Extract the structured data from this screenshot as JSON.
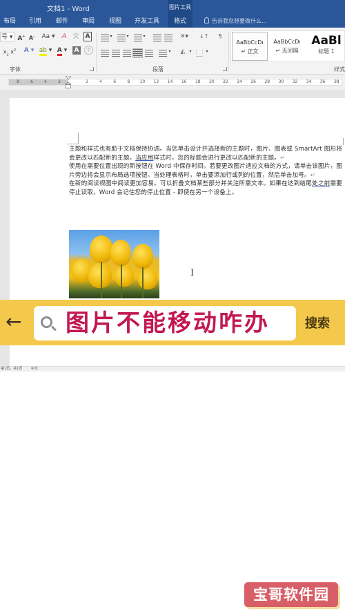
{
  "window": {
    "title": "文档1 - Word",
    "context_tab_group": "图片工具"
  },
  "tabs": [
    {
      "label": "布局"
    },
    {
      "label": "引用"
    },
    {
      "label": "邮件"
    },
    {
      "label": "审阅"
    },
    {
      "label": "视图"
    },
    {
      "label": "开发工具"
    },
    {
      "label": "格式"
    }
  ],
  "tell_me": {
    "placeholder": "告诉我您想要做什么..."
  },
  "ribbon": {
    "font_group": {
      "label": "字体",
      "font_size_suffix": "号",
      "grow_font": "A",
      "shrink_font": "A",
      "change_case": "Aa",
      "clear_format": "A",
      "char_border": "A",
      "subscript": "x",
      "superscript": "x",
      "text_effects": "A",
      "font_color": "A",
      "char_shading": "A",
      "enclose_char": "字"
    },
    "paragraph_group": {
      "label": "段落"
    },
    "styles_group": {
      "label": "样式",
      "items": [
        {
          "sample": "AaBbCcDı",
          "name": "↵ 正文",
          "selected": true
        },
        {
          "sample": "AaBbCcDı",
          "name": "↵ 无间隔",
          "selected": false
        },
        {
          "sample": "AaBl",
          "name": "标题 1",
          "selected": false
        }
      ]
    }
  },
  "ruler": {
    "left_numbers": [
      "8",
      "6",
      "4",
      "2"
    ],
    "right_numbers": [
      "2",
      "4",
      "6",
      "8",
      "10",
      "12",
      "14",
      "16",
      "18",
      "20",
      "22",
      "24",
      "26",
      "28",
      "30",
      "32",
      "34",
      "36",
      "38"
    ]
  },
  "document": {
    "paragraphs": [
      {
        "before": "主题和样式也有助于文档保持协调。当您单击设计并选择新的主题时，图片、图表或 SmartArt 图形将会更改以匹配新的主题。",
        "underlined": "当应用",
        "after": "样式时，您的标题会进行更改以匹配新的主题。",
        "mark": "↵"
      },
      {
        "before": "使用在需要位置出现的新按钮在 Word 中保存时间。若要更改图片适应文档的方式，请单击该图片，图片旁边将会显示布局选项按钮。当处理表格时，单击要添加行或列的位置，然后单击加号。",
        "underlined": "",
        "after": "",
        "mark": "↵"
      },
      {
        "before": "在新的阅读视图中阅读更加容易。可以折叠文档某些部分并关注所需文本。如果在达到结尾",
        "underlined": "处之前",
        "after": "需要停止读取，Word 会记住您的停止位置 - 即使在另一个设备上。",
        "mark": ""
      }
    ],
    "image_alt": "黄色郁金香图片"
  },
  "search_overlay": {
    "query": "图片不能移动咋办",
    "button_label": "搜索",
    "back_icon": "←",
    "colors": {
      "bar": "#f4c94b",
      "query_text": "#c2184f"
    }
  },
  "statusbar": {
    "page_info": "第1页，共1页",
    "words": "中文"
  },
  "watermark": {
    "text": "宝哥软件园",
    "color": "#d85f67"
  }
}
